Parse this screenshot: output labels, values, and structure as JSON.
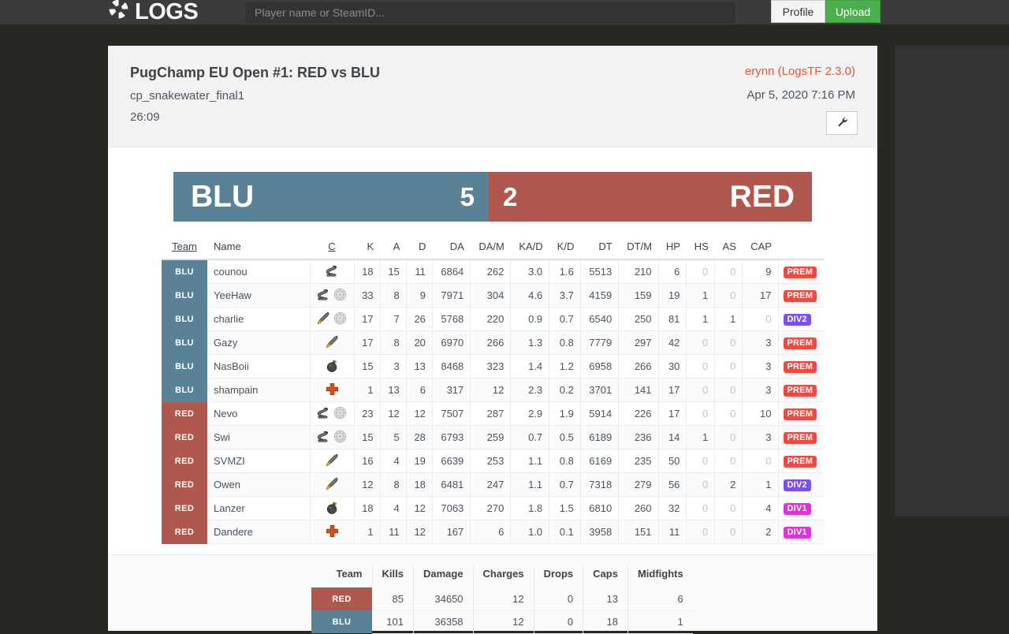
{
  "navbar": {
    "brand": "LOGS",
    "brand_icon": "logs-crosshair-icon",
    "search_placeholder": "Player name or SteamID...",
    "search_value": "",
    "profile_label": "Profile",
    "upload_label": "Upload"
  },
  "log": {
    "title": "PugChamp EU Open #1: RED vs BLU",
    "map": "cp_snakewater_final1",
    "duration": "26:09",
    "uploader": "erynn (LogsTF 2.3.0)",
    "date": "Apr 5, 2020 7:16 PM",
    "settings_icon": "wrench-icon"
  },
  "scoreboard": {
    "blu_name": "BLU",
    "blu_score": "5",
    "red_score": "2",
    "red_name": "RED"
  },
  "colors": {
    "blu": "#5a8296",
    "red": "#b0584e",
    "prem": "#ef4a42",
    "div2": "#7b4ff0",
    "div1": "#dd33dd",
    "upload_green": "#4cae4c",
    "uploader_link": "#e8563a"
  },
  "player_table": {
    "headers": [
      "Team",
      "Name",
      "C",
      "K",
      "A",
      "D",
      "DA",
      "DA/M",
      "KA/D",
      "K/D",
      "DT",
      "DT/M",
      "HP",
      "HS",
      "AS",
      "CAP",
      ""
    ],
    "sorted_headers": [
      "Team",
      "C"
    ],
    "rows": [
      {
        "team": "BLU",
        "name": "counou",
        "classes": [
          "scout"
        ],
        "k": "18",
        "a": "15",
        "d": "11",
        "da": "6864",
        "dam": "262",
        "kad": "3.0",
        "kd": "1.6",
        "dt": "5513",
        "dtm": "210",
        "hp": "6",
        "hs": "0",
        "as": "0",
        "cap": "9",
        "badge": "PREM"
      },
      {
        "team": "BLU",
        "name": "YeeHaw",
        "classes": [
          "scout",
          "medal"
        ],
        "k": "33",
        "a": "8",
        "d": "9",
        "da": "7971",
        "dam": "304",
        "kad": "4.6",
        "kd": "3.7",
        "dt": "4159",
        "dtm": "159",
        "hp": "19",
        "hs": "1",
        "as": "0",
        "cap": "17",
        "badge": "PREM"
      },
      {
        "team": "BLU",
        "name": "charlie",
        "classes": [
          "soldier",
          "medal"
        ],
        "k": "17",
        "a": "7",
        "d": "26",
        "da": "5768",
        "dam": "220",
        "kad": "0.9",
        "kd": "0.7",
        "dt": "6540",
        "dtm": "250",
        "hp": "81",
        "hs": "1",
        "as": "1",
        "cap": "0",
        "badge": "DIV2"
      },
      {
        "team": "BLU",
        "name": "Gazy",
        "classes": [
          "soldier"
        ],
        "k": "17",
        "a": "8",
        "d": "20",
        "da": "6970",
        "dam": "266",
        "kad": "1.3",
        "kd": "0.8",
        "dt": "7779",
        "dtm": "297",
        "hp": "42",
        "hs": "0",
        "as": "0",
        "cap": "3",
        "badge": "PREM"
      },
      {
        "team": "BLU",
        "name": "NasBoii",
        "classes": [
          "demoman"
        ],
        "k": "15",
        "a": "3",
        "d": "13",
        "da": "8468",
        "dam": "323",
        "kad": "1.4",
        "kd": "1.2",
        "dt": "6958",
        "dtm": "266",
        "hp": "30",
        "hs": "0",
        "as": "0",
        "cap": "3",
        "badge": "PREM"
      },
      {
        "team": "BLU",
        "name": "shampain",
        "classes": [
          "medic"
        ],
        "k": "1",
        "a": "13",
        "d": "6",
        "da": "317",
        "dam": "12",
        "kad": "2.3",
        "kd": "0.2",
        "dt": "3701",
        "dtm": "141",
        "hp": "17",
        "hs": "0",
        "as": "0",
        "cap": "3",
        "badge": "PREM"
      },
      {
        "team": "RED",
        "name": "Nevo",
        "classes": [
          "scout",
          "medal"
        ],
        "k": "23",
        "a": "12",
        "d": "12",
        "da": "7507",
        "dam": "287",
        "kad": "2.9",
        "kd": "1.9",
        "dt": "5914",
        "dtm": "226",
        "hp": "17",
        "hs": "0",
        "as": "0",
        "cap": "10",
        "badge": "PREM"
      },
      {
        "team": "RED",
        "name": "Swi",
        "classes": [
          "scout",
          "medal"
        ],
        "k": "15",
        "a": "5",
        "d": "28",
        "da": "6793",
        "dam": "259",
        "kad": "0.7",
        "kd": "0.5",
        "dt": "6189",
        "dtm": "236",
        "hp": "14",
        "hs": "1",
        "as": "0",
        "cap": "3",
        "badge": "PREM"
      },
      {
        "team": "RED",
        "name": "SVMZI",
        "classes": [
          "soldier"
        ],
        "k": "16",
        "a": "4",
        "d": "19",
        "da": "6639",
        "dam": "253",
        "kad": "1.1",
        "kd": "0.8",
        "dt": "6169",
        "dtm": "235",
        "hp": "50",
        "hs": "0",
        "as": "0",
        "cap": "0",
        "badge": "PREM"
      },
      {
        "team": "RED",
        "name": "Owen",
        "classes": [
          "soldier"
        ],
        "k": "12",
        "a": "8",
        "d": "18",
        "da": "6481",
        "dam": "247",
        "kad": "1.1",
        "kd": "0.7",
        "dt": "7318",
        "dtm": "279",
        "hp": "56",
        "hs": "0",
        "as": "2",
        "cap": "1",
        "badge": "DIV2"
      },
      {
        "team": "RED",
        "name": "Lanzer",
        "classes": [
          "demoman"
        ],
        "k": "18",
        "a": "4",
        "d": "12",
        "da": "7063",
        "dam": "270",
        "kad": "1.8",
        "kd": "1.5",
        "dt": "6810",
        "dtm": "260",
        "hp": "32",
        "hs": "0",
        "as": "0",
        "cap": "4",
        "badge": "DIV1"
      },
      {
        "team": "RED",
        "name": "Dandere",
        "classes": [
          "medic"
        ],
        "k": "1",
        "a": "11",
        "d": "12",
        "da": "167",
        "dam": "6",
        "kad": "1.0",
        "kd": "0.1",
        "dt": "3958",
        "dtm": "151",
        "hp": "11",
        "hs": "0",
        "as": "0",
        "cap": "2",
        "badge": "DIV1"
      }
    ]
  },
  "summary_table": {
    "headers": [
      "Team",
      "Kills",
      "Damage",
      "Charges",
      "Drops",
      "Caps",
      "Midfights"
    ],
    "rows": [
      {
        "team": "RED",
        "kills": "85",
        "damage": "34650",
        "charges": "12",
        "drops": "0",
        "caps": "13",
        "midfights": "6"
      },
      {
        "team": "BLU",
        "kills": "101",
        "damage": "36358",
        "charges": "12",
        "drops": "0",
        "caps": "18",
        "midfights": "1"
      }
    ]
  }
}
